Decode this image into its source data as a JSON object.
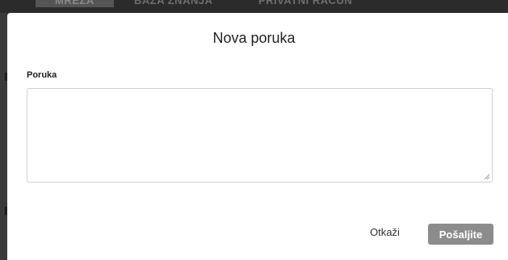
{
  "background_nav": {
    "items": [
      {
        "label": "MREŽA"
      },
      {
        "label": "BAZA ZNANJA"
      },
      {
        "label": "PRIVATNI RAČUN"
      }
    ]
  },
  "modal": {
    "title": "Nova poruka",
    "field_label": "Poruka",
    "textarea_value": "",
    "cancel_label": "Otkaži",
    "send_label": "Pošaljite"
  },
  "colors": {
    "overlay": "#3a3a3a",
    "send_button_bg": "#8c8c8c",
    "textarea_border": "#cfcfcf"
  }
}
